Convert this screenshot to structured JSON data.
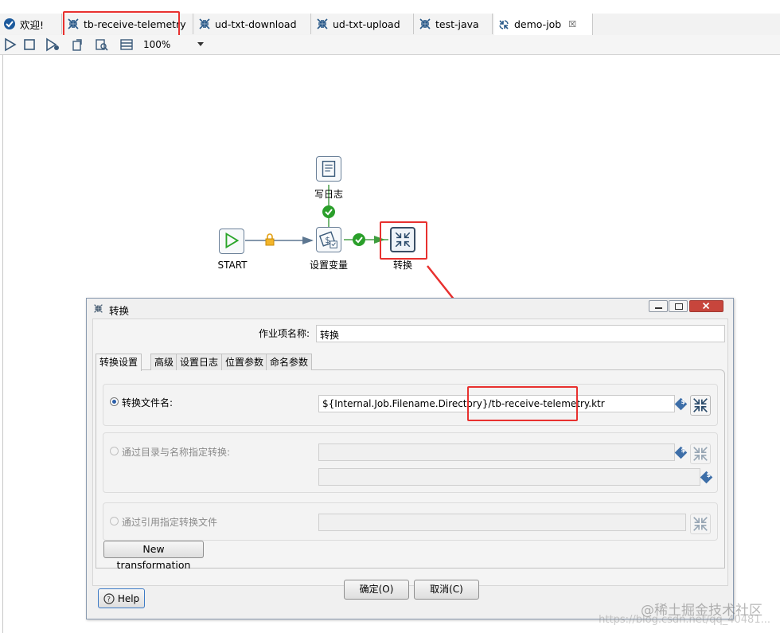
{
  "tabs": [
    {
      "label": "欢迎!",
      "icon": "welcome-icon",
      "active": false
    },
    {
      "label": "tb-receive-telemetry",
      "icon": "transformation-icon",
      "active": false,
      "highlighted": true
    },
    {
      "label": "ud-txt-download",
      "icon": "transformation-icon",
      "active": false
    },
    {
      "label": "ud-txt-upload",
      "icon": "transformation-icon",
      "active": false
    },
    {
      "label": "test-java",
      "icon": "transformation-icon",
      "active": false
    },
    {
      "label": "demo-job",
      "icon": "job-icon",
      "active": true,
      "close": "☒"
    }
  ],
  "toolbar": {
    "icons": [
      "run-icon",
      "stop-icon",
      "debug-icon",
      "replay-icon",
      "verify-icon",
      "sql-icon"
    ],
    "zoom": "100%"
  },
  "job": {
    "nodes": [
      {
        "id": "start",
        "label": "START",
        "icon": "start-icon"
      },
      {
        "id": "write_log",
        "label": "写日志",
        "icon": "write-log-icon"
      },
      {
        "id": "set_vars",
        "label": "设置变量",
        "icon": "set-variables-icon"
      },
      {
        "id": "transform",
        "label": "转换",
        "icon": "transformation-icon",
        "highlighted": true
      }
    ],
    "hops": [
      {
        "from": "start",
        "to": "set_vars",
        "type": "unconditional",
        "icon": "lock-icon"
      },
      {
        "from": "set_vars",
        "to": "write_log",
        "type": "success",
        "icon": "check-icon"
      },
      {
        "from": "set_vars",
        "to": "transform",
        "type": "success",
        "icon": "check-icon"
      }
    ]
  },
  "dialog": {
    "title": "转换",
    "name_label": "作业项名称:",
    "name_value": "转换",
    "tabs": [
      "转换设置",
      "高级",
      "设置日志",
      "位置参数",
      "命名参数"
    ],
    "active_tab": "转换设置",
    "option_file": {
      "label": "转换文件名:",
      "selected": true,
      "value": "${Internal.Job.Filename.Directory}/tb-receive-telemetry.ktr"
    },
    "option_repo": {
      "label": "通过目录与名称指定转换:",
      "selected": false,
      "directory": "",
      "name": ""
    },
    "option_ref": {
      "label": "通过引用指定转换文件",
      "selected": false,
      "value": ""
    },
    "new_transformation": "New transformation",
    "help": "Help",
    "ok": "确定(O)",
    "cancel": "取消(C)",
    "variable_glyph": "$"
  },
  "watermark": {
    "text": "@稀土掘金技术社区",
    "url": "https://blog.csdn.net/qq_40481..."
  }
}
